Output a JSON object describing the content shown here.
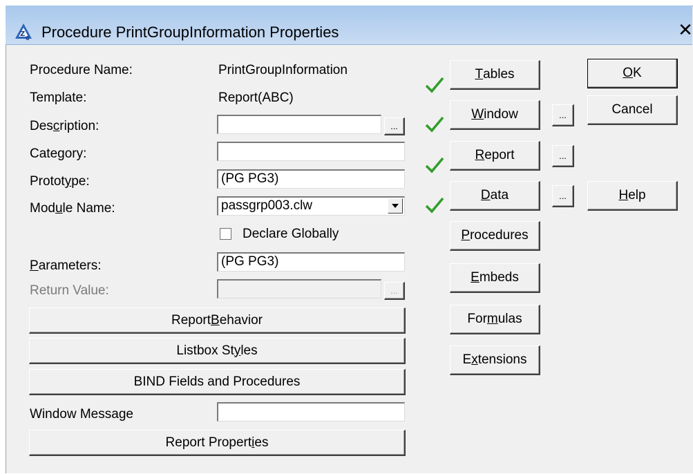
{
  "window": {
    "title": "Procedure PrintGroupInformation Properties",
    "close_glyph": "✕"
  },
  "labels": {
    "procedure_name": "Procedure Name:",
    "template": "Template:",
    "description": [
      "Des",
      "c",
      "ription:"
    ],
    "category": "Category:",
    "prototype": [
      "Protot",
      "y",
      "pe:"
    ],
    "module_name": [
      "Mod",
      "u",
      "le Name:"
    ],
    "parameters": [
      "",
      "P",
      "arameters:"
    ],
    "return_value": "Return Value:",
    "window_message": "Window Message"
  },
  "values": {
    "procedure_name": "PrintGroupInformation",
    "template": "Report(ABC)",
    "description": "",
    "category": "",
    "prototype": "(PG PG3)",
    "module_name": "passgrp003.clw",
    "parameters": "(PG PG3)",
    "return_value": "",
    "window_message": ""
  },
  "declare_globally": {
    "label": "Declare Globally",
    "checked": false
  },
  "left_buttons": {
    "report_behavior": [
      "Report ",
      "B",
      "ehavior"
    ],
    "listbox_styles": [
      "Listbox St",
      "y",
      "les"
    ],
    "bind_fields": [
      "BIND Fields and Procedures",
      "",
      ""
    ],
    "report_properties": [
      "Report Propert",
      "i",
      "es"
    ]
  },
  "middle_buttons": {
    "tables": [
      "",
      "T",
      "ables"
    ],
    "window": [
      "",
      "W",
      "indow"
    ],
    "report": [
      "",
      "R",
      "eport"
    ],
    "data": [
      "",
      "D",
      "ata"
    ],
    "procedures": [
      "",
      "P",
      "rocedures"
    ],
    "embeds": [
      "",
      "E",
      "mbeds"
    ],
    "formulas": [
      "For",
      "m",
      "ulas"
    ],
    "extensions": [
      "E",
      "x",
      "tensions"
    ],
    "ellipsis": "..."
  },
  "right_buttons": {
    "ok": [
      "",
      "O",
      "K"
    ],
    "cancel": [
      "Cancel",
      "",
      ""
    ],
    "help": [
      "",
      "H",
      "elp"
    ]
  },
  "icons": {
    "app": "clarion-app-icon",
    "check": "green-check-icon",
    "dropdown": "dropdown-arrow-icon",
    "close": "close-icon"
  },
  "colors": {
    "check_green": "#2f9e2a",
    "titlebar_top": "#a8c8ec",
    "titlebar_bottom": "#c9dcf3"
  }
}
